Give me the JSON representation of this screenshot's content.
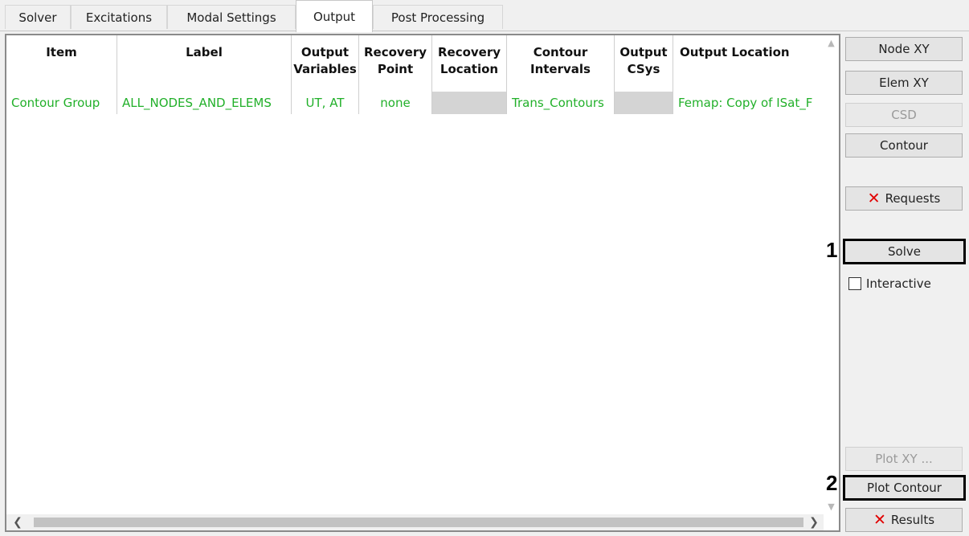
{
  "tabs": [
    {
      "label": "Solver",
      "active": false
    },
    {
      "label": "Excitations",
      "active": false
    },
    {
      "label": "Modal Settings",
      "active": false
    },
    {
      "label": "Output",
      "active": true
    },
    {
      "label": "Post Processing",
      "active": false
    }
  ],
  "table": {
    "columns": [
      {
        "line1": "Item",
        "line2": ""
      },
      {
        "line1": "Label",
        "line2": ""
      },
      {
        "line1": "Output",
        "line2": "Variables"
      },
      {
        "line1": "Recovery",
        "line2": "Point"
      },
      {
        "line1": "Recovery",
        "line2": "Location"
      },
      {
        "line1": "Contour",
        "line2": "Intervals"
      },
      {
        "line1": "Output",
        "line2": "CSys"
      },
      {
        "line1": "Output Location",
        "line2": ""
      }
    ],
    "rows": [
      {
        "item": "Contour Group",
        "label": "ALL_NODES_AND_ELEMS",
        "output_variables": "UT, AT",
        "recovery_point": "none",
        "recovery_location": "",
        "contour_intervals": "Trans_Contours",
        "output_csys": "",
        "output_location": "Femap: Copy of ISat_F"
      }
    ],
    "row_text_color": "#22b02a"
  },
  "buttons": {
    "node_xy": "Node XY",
    "elem_xy": "Elem XY",
    "csd": "CSD",
    "contour": "Contour",
    "requests": "Requests",
    "solve": "Solve",
    "plot_xy": "Plot XY ...",
    "plot_contour": "Plot Contour",
    "results": "Results"
  },
  "interactive_checkbox": {
    "label": "Interactive",
    "checked": false
  },
  "step_markers": {
    "solve": "1",
    "plot_contour": "2"
  },
  "icons": {
    "delete": "red-x-icon"
  }
}
